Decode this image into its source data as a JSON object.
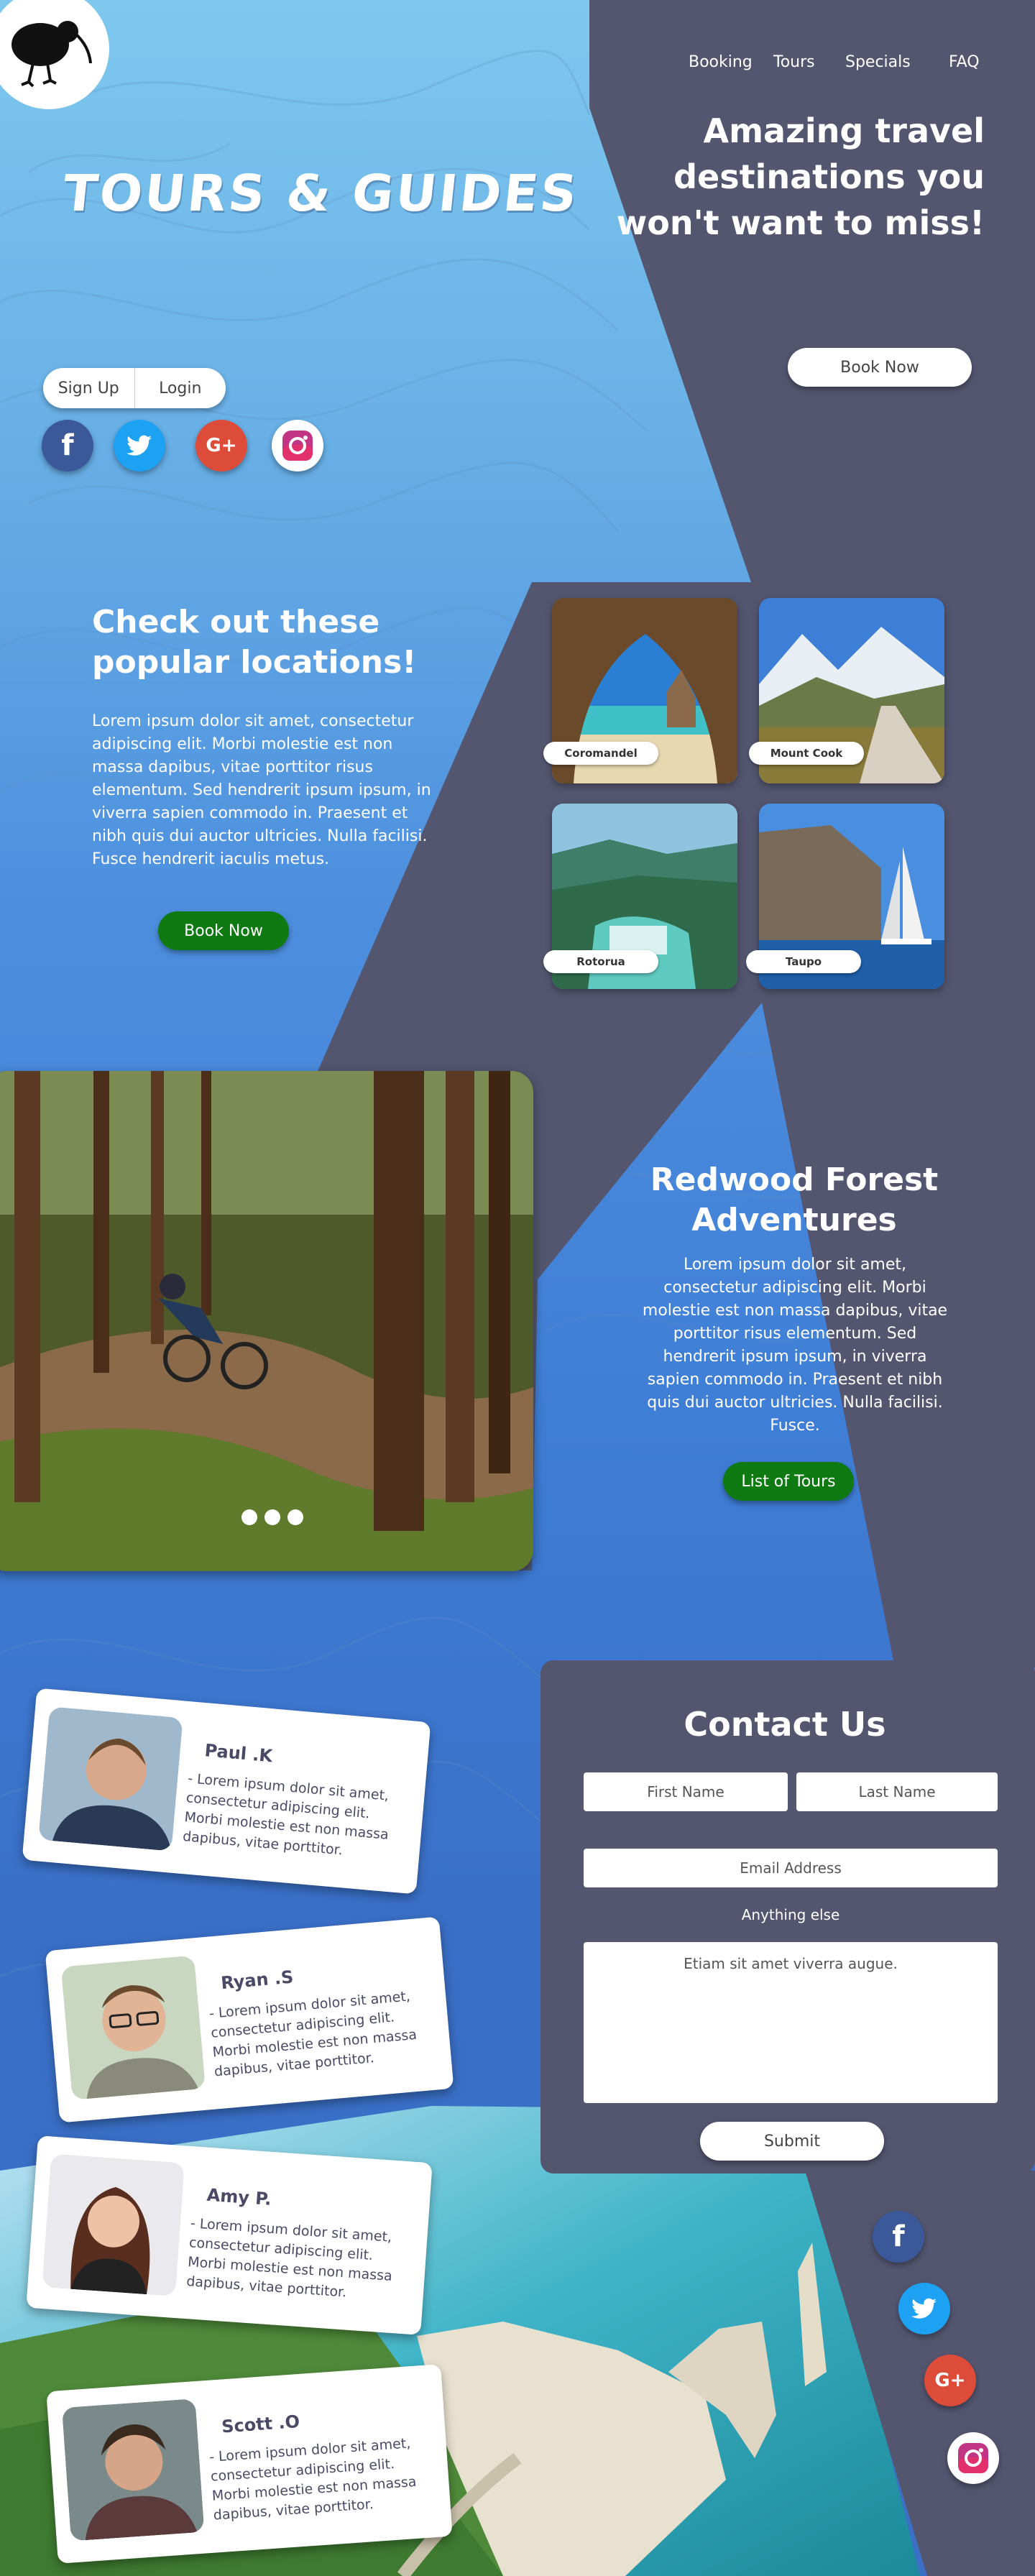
{
  "nav": {
    "items": [
      "Booking",
      "Tours",
      "Specials",
      "FAQ"
    ]
  },
  "hero": {
    "brand": "TOURS & GUIDES",
    "tagline": "Amazing travel destinations you won't want to miss!",
    "cta": "Book Now",
    "signup": "Sign Up",
    "login": "Login"
  },
  "social": {
    "facebook": "f",
    "twitter": "twitter-icon",
    "google": "G+",
    "instagram": "instagram-icon"
  },
  "popular": {
    "heading": "Check out these popular locations!",
    "body": "Lorem ipsum dolor sit amet, consectetur adipiscing elit. Morbi molestie est non massa dapibus, vitae porttitor risus elementum. Sed hendrerit ipsum ipsum, in viverra sapien commodo in. Praesent et nibh quis dui auctor ultricies. Nulla facilisi. Fusce hendrerit iaculis metus.",
    "cta": "Book Now",
    "locations": [
      "Coromandel",
      "Mount Cook",
      "Rotorua",
      "Taupo"
    ]
  },
  "redwood": {
    "heading": "Redwood Forest Adventures",
    "body": "Lorem ipsum dolor sit amet, consectetur adipiscing elit. Morbi molestie est non massa dapibus, vitae porttitor risus elementum. Sed hendrerit ipsum ipsum, in viverra sapien commodo in. Praesent et nibh quis dui auctor ultricies. Nulla facilisi. Fusce.",
    "cta": "List of Tours"
  },
  "testimonials": [
    {
      "name": "Paul .K",
      "text": "- Lorem ipsum dolor sit amet, consectetur adipiscing elit. Morbi molestie est non massa dapibus, vitae porttitor."
    },
    {
      "name": "Ryan .S",
      "text": "- Lorem ipsum dolor sit amet, consectetur adipiscing elit. Morbi molestie est non massa dapibus, vitae porttitor."
    },
    {
      "name": "Amy P.",
      "text": "- Lorem ipsum dolor sit amet, consectetur adipiscing elit. Morbi molestie est non massa dapibus, vitae porttitor."
    },
    {
      "name": "Scott .O",
      "text": "- Lorem ipsum dolor sit amet, consectetur adipiscing elit. Morbi molestie est non massa dapibus, vitae porttitor."
    }
  ],
  "contact": {
    "heading": "Contact Us",
    "first_name": "First Name",
    "last_name": "Last Name",
    "email": "Email Address",
    "anything_label": "Anything else",
    "message_placeholder": "Etiam sit amet viverra augue.",
    "submit": "Submit"
  },
  "colors": {
    "panel": "#545670",
    "accent_green": "#0f7a12",
    "sky": "#7ec8ee",
    "blue": "#3f7ed6"
  }
}
